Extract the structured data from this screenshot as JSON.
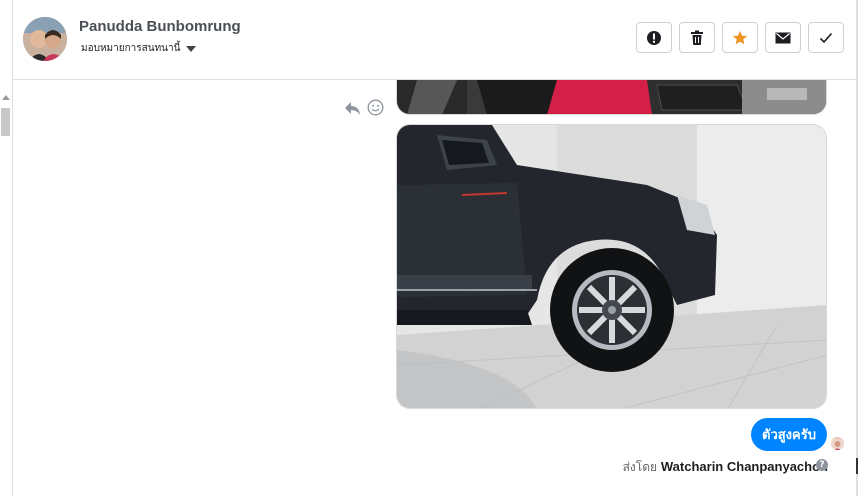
{
  "conversation": {
    "name": "Panudda Bunbomrung",
    "assign_label": "มอบหมายการสนทนานี้"
  },
  "toolbar": {
    "buttons": [
      {
        "icon": "exclamation-icon",
        "label": "Mark as spam"
      },
      {
        "icon": "trash-icon",
        "label": "Delete"
      },
      {
        "icon": "star-icon",
        "label": "Follow up",
        "color": "#f0952a"
      },
      {
        "icon": "envelope-icon",
        "label": "Mark as unread"
      },
      {
        "icon": "check-icon",
        "label": "Mark as done"
      }
    ]
  },
  "message_tools": [
    "reply-icon",
    "emoji-icon"
  ],
  "messages": {
    "images": [
      {
        "description_icon": "photo"
      },
      {
        "description_icon": "photo"
      }
    ],
    "text_bubble": "ตัวสูงครับ",
    "bubble_color": "#0084ff"
  },
  "footer": {
    "sent_by_prefix": "ส่งโดย",
    "sent_by_name": "Watcharin Chanpanyachon",
    "help_icon": "?"
  }
}
